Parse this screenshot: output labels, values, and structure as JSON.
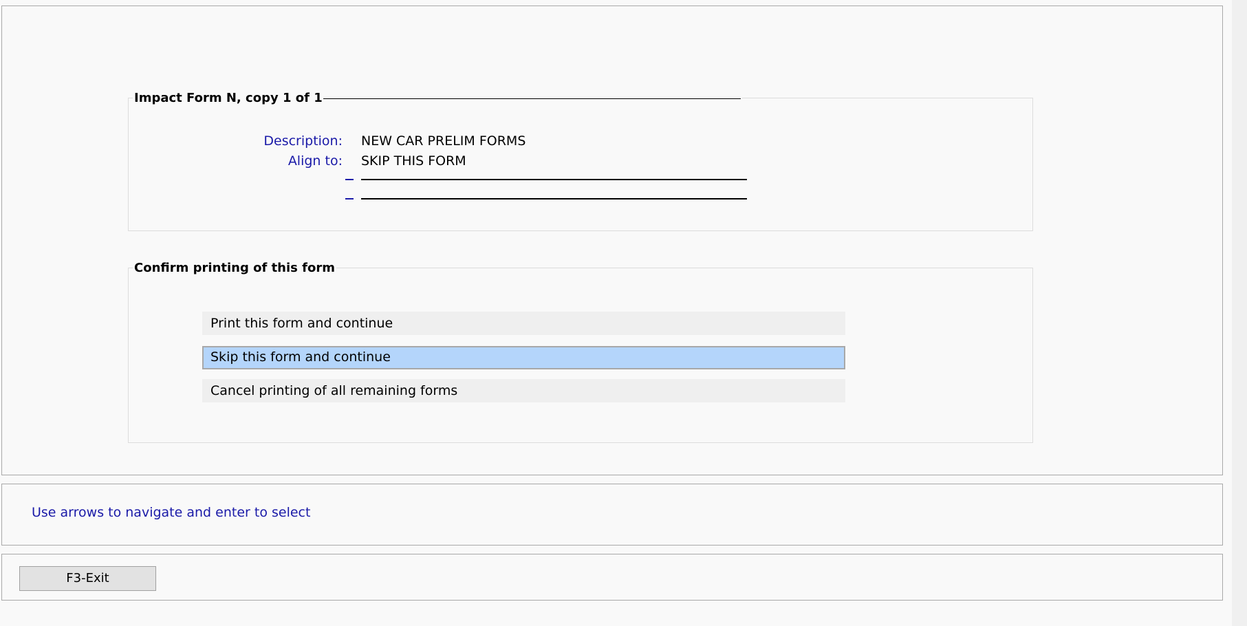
{
  "form_section": {
    "title": "Impact Form N, copy 1 of 1",
    "fields": [
      {
        "label": "Description:",
        "value": "NEW CAR PRELIM FORMS"
      },
      {
        "label": "Align to:",
        "value": "SKIP THIS FORM"
      }
    ]
  },
  "confirm_section": {
    "title": "Confirm printing of this form",
    "options": [
      {
        "label": "Print this form and continue"
      },
      {
        "label": "Skip this form and continue"
      },
      {
        "label": "Cancel printing of all remaining forms"
      }
    ],
    "selected_option": "Skip this form and continue"
  },
  "status": {
    "message": "Use arrows to navigate and enter to select"
  },
  "function_keys": {
    "exit_label": "F3-Exit"
  },
  "colors": {
    "label_blue": "#1a1aa8",
    "selection_blue": "#b4d5fb",
    "panel_border": "#a8a8a8",
    "background": "#f9f9f9"
  }
}
